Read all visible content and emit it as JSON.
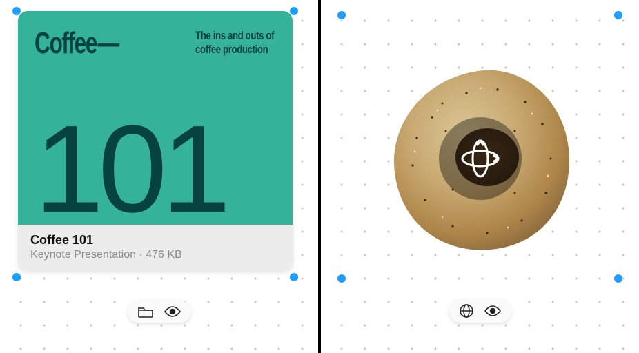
{
  "left": {
    "slide": {
      "title": "Coffee",
      "tagline": "The ins and outs of coffee production",
      "number": "101"
    },
    "file": {
      "name": "Coffee 101",
      "meta": "Keynote Presentation · 476 KB"
    }
  },
  "right": {
    "object_name": "bagel"
  },
  "icons": {
    "folder": "folder-icon",
    "eye": "eye-icon",
    "globe": "globe-icon",
    "rotate3d": "rotate-3d-icon"
  }
}
